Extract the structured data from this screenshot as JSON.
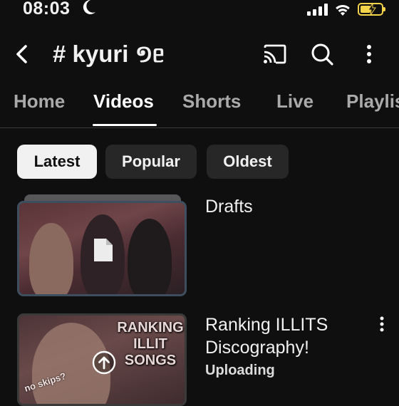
{
  "status_bar": {
    "time": "08:03",
    "icons": [
      "moon-icon",
      "signal-icon",
      "wifi-icon",
      "battery-charging-icon"
    ],
    "battery_color": "#f4d54a"
  },
  "header": {
    "back_icon": "back-arrow-icon",
    "channel_title": "# kyuri ១ᥱ",
    "action_icons": [
      "cast-icon",
      "search-icon",
      "more-vertical-icon"
    ]
  },
  "tabs": [
    {
      "label": "Home",
      "active": false
    },
    {
      "label": "Videos",
      "active": true
    },
    {
      "label": "Shorts",
      "active": false
    },
    {
      "label": "Live",
      "active": false
    },
    {
      "label": "Playlis",
      "active": false
    }
  ],
  "filters": [
    {
      "label": "Latest",
      "active": true
    },
    {
      "label": "Popular",
      "active": false
    },
    {
      "label": "Oldest",
      "active": false
    }
  ],
  "videos": [
    {
      "title": "Drafts",
      "thumb_icon": "document-icon",
      "thumb_border_color": "#3f4e5e"
    },
    {
      "title": "Ranking ILLITS Discography!",
      "status": "Uploading",
      "thumb_overlay_lines": [
        "RANKING",
        "ILLIT",
        "SONGS"
      ],
      "thumb_caption": "no skips?",
      "thumb_icon": "upload-arrow-icon",
      "menu_icon": "more-vertical-icon"
    }
  ],
  "colors": {
    "background": "#0f0f0f",
    "text": "#f1f1f1",
    "inactive_tab": "#aaaaaa",
    "chip_bg": "#272727",
    "chip_active_bg": "#f1f1f1"
  }
}
